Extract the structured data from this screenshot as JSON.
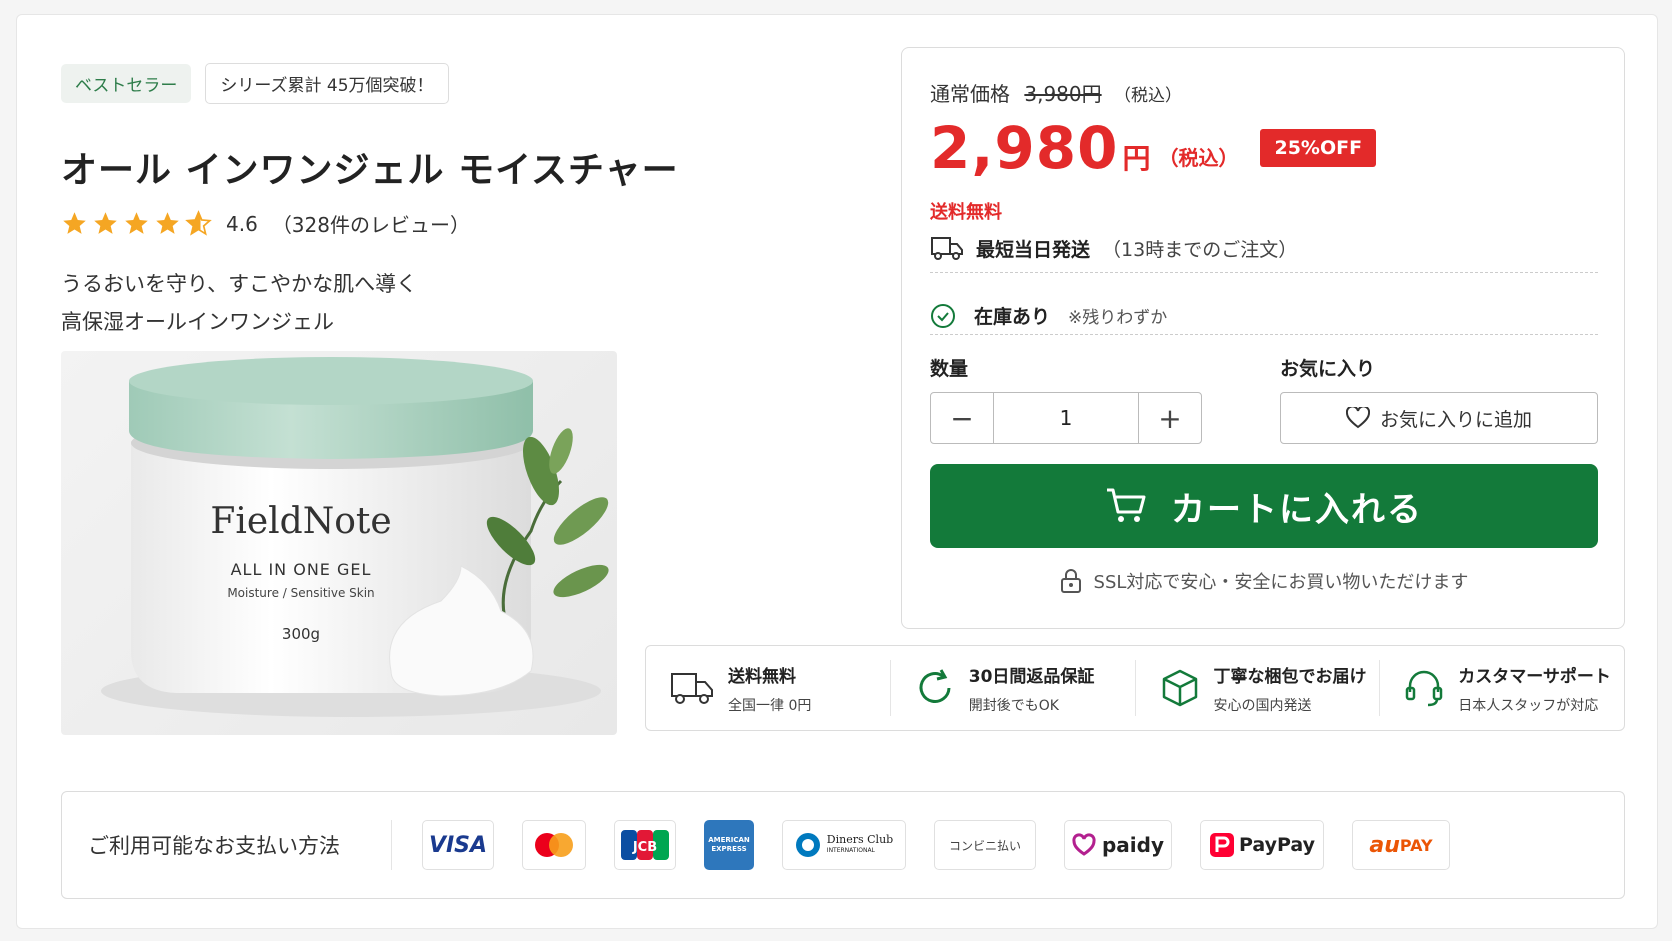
{
  "badges": {
    "best": "ベストセラー",
    "series": "シリーズ累計 45万個突破！"
  },
  "product": {
    "title": "オール インワンジェル モイスチャー",
    "rating_value": "4.6",
    "rating_count": "（328件のレビュー）",
    "rating": 4.6,
    "desc_line1": "うるおいを守り、すこやかな肌へ導く",
    "desc_line2": "高保湿オールインワンジェル",
    "image": {
      "brand": "FieldNote",
      "line1": "ALL IN ONE GEL",
      "line2": "Moisture / Sensitive Skin",
      "size": "300g"
    }
  },
  "buybox": {
    "regular_label": "通常価格",
    "regular_price": "3,980円",
    "regular_tax": "（税込）",
    "price": "2,980",
    "yen": "円",
    "tax": "（税込）",
    "discount": "25%OFF",
    "free_shipping": "送料無料",
    "ship_bold": "最短当日発送",
    "ship_note": "（13時までのご注文）",
    "stock": "在庫あり",
    "stock_note": "※残りわずか",
    "qty_label": "数量",
    "qty_value": "1",
    "minus": "−",
    "plus": "+",
    "fav_label": "お気に入り",
    "fav_button": "お気に入りに追加",
    "cart_button": "カートに入れる",
    "ssl": "SSL対応で安心・安全にお買い物いただけます"
  },
  "features": [
    {
      "title": "送料無料",
      "sub": "全国一律 0円",
      "icon": "truck-icon"
    },
    {
      "title": "30日間返品保証",
      "sub": "開封後でもOK",
      "icon": "return-icon"
    },
    {
      "title": "丁寧な梱包でお届け",
      "sub": "安心の国内発送",
      "icon": "box-icon"
    },
    {
      "title": "カスタマーサポート",
      "sub": "日本人スタッフが対応",
      "icon": "headset-icon"
    }
  ],
  "payments": {
    "label": "ご利用可能なお支払い方法",
    "visa": "VISA",
    "jcb": "JCB",
    "amex_1": "AMERICAN",
    "amex_2": "EXPRESS",
    "diners_1": "Diners Club",
    "diners_2": "INTERNATIONAL",
    "konbini": "コンビニ払い",
    "paidy": "paidy",
    "paypay": "PayPay",
    "aupay_1": "au",
    "aupay_2": "PAY"
  },
  "colors": {
    "accent_green": "#137a3a",
    "price_red": "#e32a2a",
    "star": "#f5a623"
  }
}
